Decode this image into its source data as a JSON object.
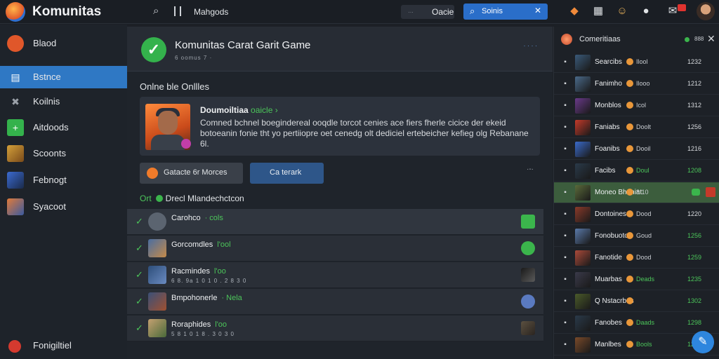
{
  "app": {
    "title": "Komunitas"
  },
  "topbar": {
    "menu_label": "Mahgods",
    "chip_dim": "…",
    "chip_value": "Oacie",
    "search_value": "Soinis",
    "search_icon": "search-icon",
    "icons": [
      "game-controller-icon",
      "grid-icon",
      "emoji-icon",
      "chat-icon",
      "notification-icon",
      "avatar"
    ]
  },
  "sidebar": {
    "items": [
      {
        "label": "Blaod",
        "icon": "community-icon",
        "color": "#e0572a",
        "active": false
      },
      {
        "label": "Bstnce",
        "icon": "library-icon",
        "color": "#2f6fd0",
        "active": true
      },
      {
        "label": "Koilnis",
        "icon": "tools-icon",
        "color": "#6b7280",
        "active": false
      },
      {
        "label": "Aitdoods",
        "icon": "add-icon",
        "color": "#34b24c",
        "active": false
      },
      {
        "label": "Scoonts",
        "icon": "game-thumb-icon",
        "color": "#c48a2a",
        "active": false
      },
      {
        "label": "Febnogt",
        "icon": "game-thumb-icon",
        "color": "#3b6ad0",
        "active": false
      },
      {
        "label": "Syacoot",
        "icon": "game-thumb-icon",
        "color": "#d06a3a",
        "active": false
      }
    ],
    "footer_label": "Fonigiltiel",
    "footer_icon": "settings-icon",
    "footer_color": "#d43a2f"
  },
  "main": {
    "game_title": "Komunitas Carat Garit Game",
    "game_subtitle": "6 oomus 7 ·",
    "header_dots": "· · · ·",
    "section_label": "Onlne ble Onllles",
    "feature": {
      "name": "Doumoiltiaa",
      "tag": "oaicle ›",
      "text": "Comned bchnel boegindereal ooqdle torcot cenies ace fiers fherle cicice der ekeid botoeanin fonie tht yo pertiiopre oet cenedg olt dediciel ertebeicher kefieg olg Rebanane 6l."
    },
    "btn_secondary": "Gatacte 6r Morces",
    "btn_primary": "Ca terark",
    "btn_more": "·-·",
    "list_head_prefix": "Ort",
    "list_head_label": "Drecl Mlandechctcon",
    "rows": [
      {
        "name": "Carohco",
        "status": "· cols",
        "meta": "",
        "av": "#5b6470",
        "round": true,
        "end": "#3bb54c"
      },
      {
        "name": "Gorcomdles",
        "status": "l'ool",
        "meta": "",
        "av": "#4a6da0",
        "round": false,
        "end": "#3bb54c"
      },
      {
        "name": "Racmindes",
        "status": "l'oo",
        "meta": "6 8. 9a 1 0 1 0 . 2 8 3 0",
        "av": "#2d4e7a",
        "round": false,
        "end": "#2a2f37"
      },
      {
        "name": "Bmpohonerle",
        "status": "· Nela",
        "meta": "",
        "av": "#3a5078",
        "round": false,
        "end": "#3bb54c"
      },
      {
        "name": "Roraphides",
        "status": "l'oo",
        "meta": "5 8 1 0 1 8 . 3 0 3 0",
        "av": "#c4a070",
        "round": false,
        "end": "#5b5040"
      }
    ]
  },
  "right_panel": {
    "title": "Comeritiaas",
    "mid": "888",
    "rows": [
      {
        "lic": "▪",
        "thumb": "#3a5a7a",
        "name": "Searcibs",
        "sub": "Ilool",
        "tm": "1232",
        "green_tm": false
      },
      {
        "lic": "▪",
        "thumb": "#4a6a8a",
        "name": "Fanimho",
        "sub": "Ilooo",
        "tm": "1212",
        "green_tm": false
      },
      {
        "lic": "▪",
        "thumb": "#6a3a8a",
        "name": "Monblos",
        "sub": "Icol",
        "tm": "1312",
        "green_tm": false
      },
      {
        "lic": "▪",
        "thumb": "#c43a2a",
        "name": "Faniabs",
        "sub": "Doolt",
        "tm": "1256",
        "green_tm": false
      },
      {
        "lic": "▪",
        "thumb": "#3a6aca",
        "name": "Foanibs",
        "sub": "Dooil",
        "tm": "1216",
        "green_tm": false
      },
      {
        "lic": "▪",
        "thumb": "#2a3a4a",
        "name": "Facibs",
        "sub": "Doul",
        "tm": "1208",
        "green_tm": true,
        "green_sub": true
      },
      {
        "lic": "▪",
        "thumb": "#5a6a3a",
        "name": "Moneo Bhuniat",
        "sub": "8 10",
        "tm": "",
        "green_tm": true,
        "hl": true
      },
      {
        "lic": "▪",
        "thumb": "#8a3a2a",
        "name": "Dontoines",
        "sub": "Dood",
        "tm": "1220",
        "green_tm": false
      },
      {
        "lic": "▪",
        "thumb": "#5a7aaa",
        "name": "Fonobuotos",
        "sub": "Goud",
        "tm": "1256",
        "green_tm": true
      },
      {
        "lic": "▪",
        "thumb": "#aa4a3a",
        "name": "Fanotide",
        "sub": "Dood",
        "tm": "1259",
        "green_tm": true
      },
      {
        "lic": "▪",
        "thumb": "#3a3a4a",
        "name": "Muarbas",
        "sub": "Deads",
        "tm": "1235",
        "green_tm": true,
        "green_sub": true
      },
      {
        "lic": "▪",
        "thumb": "#4a5a2a",
        "name": "Q Nstacrbes",
        "sub": "",
        "tm": "1302",
        "green_tm": true
      },
      {
        "lic": "▪",
        "thumb": "#2a3a4a",
        "name": "Fanobes",
        "sub": "Daads",
        "tm": "1298",
        "green_tm": true,
        "green_sub": true
      },
      {
        "lic": "▪",
        "thumb": "#7a4a2a",
        "name": "Manlbes",
        "sub": "Bools",
        "tm": "1270",
        "green_tm": true,
        "green_sub": true
      }
    ]
  },
  "fab_icon": "edit-icon"
}
